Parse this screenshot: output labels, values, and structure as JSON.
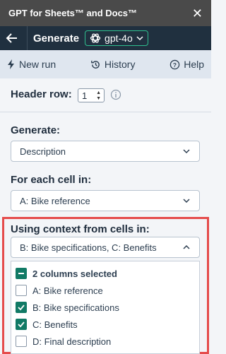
{
  "app": {
    "title": "GPT for Sheets™ and Docs™",
    "close_glyph": "✕"
  },
  "nav": {
    "page_title": "Generate",
    "model": "gpt-4o"
  },
  "tabs": [
    {
      "label": "New run",
      "icon": "bolt-icon"
    },
    {
      "label": "History",
      "icon": "history-icon"
    },
    {
      "label": "Help",
      "icon": "help-icon"
    }
  ],
  "header_row": {
    "label": "Header row:",
    "value": "1"
  },
  "generate": {
    "label": "Generate:",
    "value": "Description"
  },
  "for_each": {
    "label": "For each cell in:",
    "value": "A: Bike reference"
  },
  "context": {
    "label": "Using context from cells in:",
    "value": "B: Bike specifications, C: Benefits",
    "summary": "2 columns selected",
    "options": [
      {
        "label": "A: Bike reference",
        "checked": false
      },
      {
        "label": "B: Bike specifications",
        "checked": true
      },
      {
        "label": "C: Benefits",
        "checked": true
      },
      {
        "label": "D: Final description",
        "checked": false
      }
    ]
  },
  "colors": {
    "accent": "#117a65",
    "nav_bg": "#20303f",
    "title_bg": "#4a4a4a",
    "highlight": "#e54b4b"
  }
}
